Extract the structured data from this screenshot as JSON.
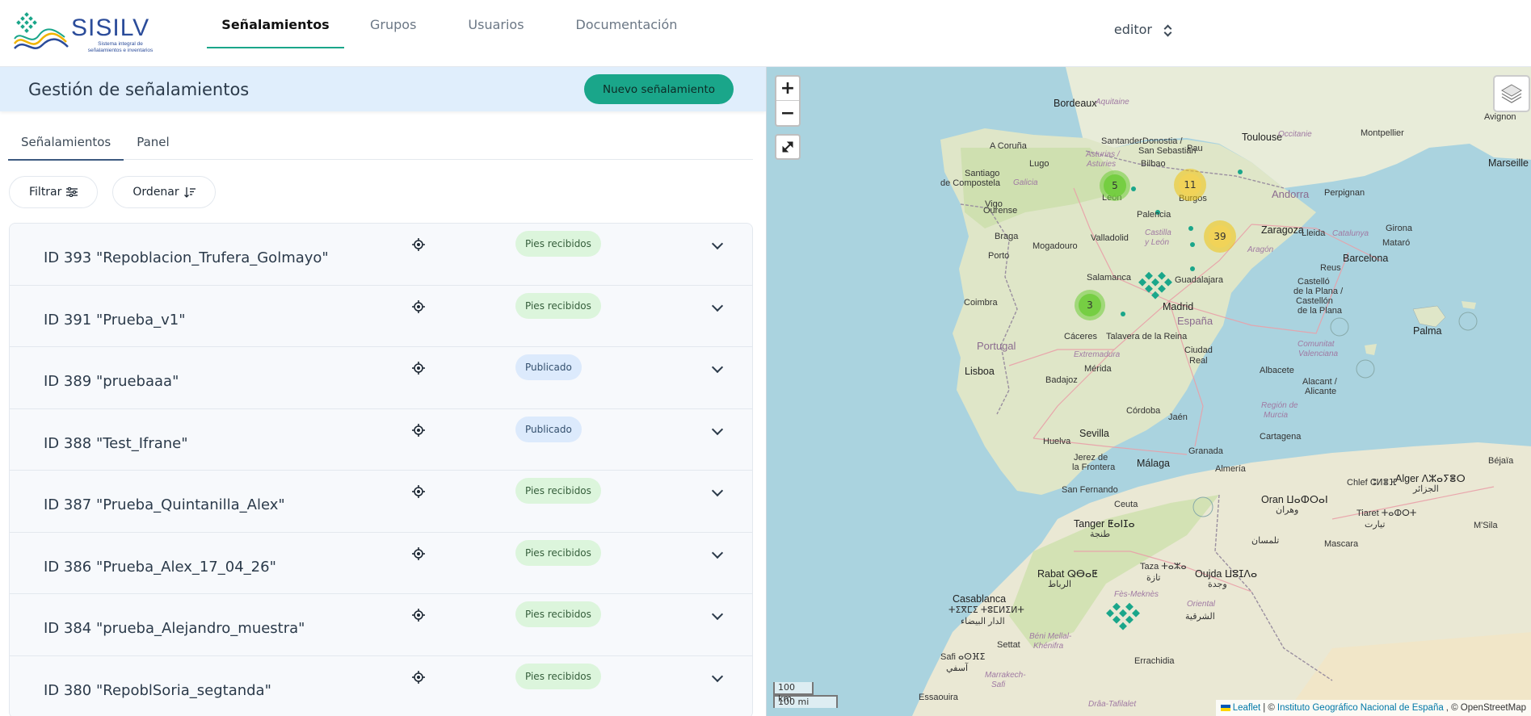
{
  "app": {
    "logo_text": "SISILV",
    "logo_subtitle": "Sistema integral de señalamientos e inventarios"
  },
  "nav": {
    "items": [
      {
        "label": "Señalamientos",
        "active": true
      },
      {
        "label": "Grupos",
        "active": false
      },
      {
        "label": "Usuarios",
        "active": false
      },
      {
        "label": "Documentación",
        "active": false
      }
    ],
    "user": "editor"
  },
  "panel": {
    "title": "Gestión de señalamientos",
    "new_button": "Nuevo señalamiento",
    "tabs": [
      {
        "label": "Señalamientos",
        "active": true
      },
      {
        "label": "Panel",
        "active": false
      }
    ],
    "filter_label": "Filtrar",
    "sort_label": "Ordenar",
    "rows": [
      {
        "title": "ID 393 \"Repoblacion_Trufera_Golmayo\"",
        "status": "Pies recibidos",
        "status_color": "green"
      },
      {
        "title": "ID 391 \"Prueba_v1\"",
        "status": "Pies recibidos",
        "status_color": "green"
      },
      {
        "title": "ID 389 \"pruebaaa\"",
        "status": "Publicado",
        "status_color": "blue"
      },
      {
        "title": "ID 388 \"Test_Ifrane\"",
        "status": "Publicado",
        "status_color": "blue"
      },
      {
        "title": "ID 387 \"Prueba_Quintanilla_Alex\"",
        "status": "Pies recibidos",
        "status_color": "green"
      },
      {
        "title": "ID 386 \"Prueba_Alex_17_04_26\"",
        "status": "Pies recibidos",
        "status_color": "green"
      },
      {
        "title": "ID 384 \"prueba_Alejandro_muestra\"",
        "status": "Pies recibidos",
        "status_color": "green"
      },
      {
        "title": "ID 380 \"RepoblSoria_segtanda\"",
        "status": "Pies recibidos",
        "status_color": "green"
      }
    ]
  },
  "map": {
    "zoom_in": "+",
    "zoom_out": "−",
    "clusters": [
      {
        "count": "5",
        "color": "green"
      },
      {
        "count": "11",
        "color": "yellow"
      },
      {
        "count": "39",
        "color": "yellow"
      },
      {
        "count": "3",
        "color": "green"
      }
    ],
    "scale_km": "100 km",
    "scale_mi": "100 mi",
    "attribution": {
      "leaflet": "Leaflet",
      "sep": "| ©",
      "ign": "Instituto Geográfico Nacional de España",
      "osm": ", © OpenStreetMap"
    },
    "labels": {
      "bordeaux": "Bordeaux",
      "aquitaine": "Aquitaine",
      "toulouse": "Toulouse",
      "occitanie": "Occitanie",
      "montpellier": "Montpellier",
      "avignon": "Avignon",
      "marseille": "Marseille",
      "pau": "Pau",
      "andorra": "Andorra",
      "perpignan": "Perpignan",
      "santander": "Santander",
      "bilbao": "Bilbao",
      "donostia": "Donostia /",
      "sansebastian": "San Sebastián",
      "acoruna": "A Coruña",
      "lugo": "Lugo",
      "asturias": "Asturias /",
      "asturies": "Asturies",
      "santiago": "Santiago",
      "decompostela": "de Compostela",
      "galicia": "Galicia",
      "ourense": "Ourense",
      "leon": "León",
      "burgos": "Burgos",
      "palencia": "Palencia",
      "vigo": "Vigo",
      "braga": "Braga",
      "porto": "Porto",
      "mogadouro": "Mogadouro",
      "valladolid": "Valladolid",
      "castilla": "Castilla",
      "yleon": "y León",
      "zaragoza": "Zaragoza",
      "lleida": "Lleida",
      "catalunya": "Catalunya",
      "girona": "Girona",
      "mataro": "Mataró",
      "barcelona": "Barcelona",
      "aragon": "Aragón",
      "salamanca": "Salamanca",
      "guadalajara": "Guadalajara",
      "madrid": "Madrid",
      "espana": "España",
      "coimbra": "Coimbra",
      "portugal": "Portugal",
      "caceres": "Cáceres",
      "talavera": "Talavera de la Reina",
      "extremadura": "Extremadura",
      "ciudad": "Ciudad",
      "real": "Real",
      "lisboa": "Lisboa",
      "badajoz": "Badajoz",
      "merida": "Mérida",
      "albacete": "Albacete",
      "castello1": "Castelló",
      "castello2": "de la Plana /",
      "castello3": "Castellón",
      "castello4": "de la Plana",
      "reus": "Reus",
      "palma": "Palma",
      "comunitat": "Comunitat",
      "valenciana": "Valenciana",
      "alacant": "Alacant /",
      "alicante": "Alicante",
      "cordoba": "Córdoba",
      "jaen": "Jaén",
      "regiondemurcia": "Región de",
      "murcia": "Murcia",
      "sevilla": "Sevilla",
      "huelva": "Huelva",
      "jerez1": "Jerez de",
      "jerez2": "la Frontera",
      "granada": "Granada",
      "malaga": "Málaga",
      "almeria": "Almería",
      "cartagena": "Cartagena",
      "sanfernando": "San Fernando",
      "ceuta": "Ceuta",
      "tanger": "Tanger ⵟⴰⵏⵊⴰ",
      "tanger_ar": "طنجة",
      "oran": "Oran ⵡⴰⵀⵔⴰⵏ",
      "oran_ar": "وهران",
      "chlef": "Chlef ⵛⵍⴻⴼ",
      "alger": "Alger ⴷⵣⴰⵢⴻⵔ",
      "alger_ar": "الجزائر",
      "bejaia": "Béjaïa",
      "tiaret": "Tiaret ⵜⴰⵀⵔⵜ",
      "tiaret_ar": "تيارت",
      "rabat": "Rabat ⵕⴱⴰⵟ",
      "rabat_ar": "الرباط",
      "taza": "Taza ⵜⴰⵣⴰ",
      "taza_ar": "تازة",
      "oujda": "Oujda ⵡⵓⵊⴷⴰ",
      "oujda_ar": "وجدة",
      "casablanca": "Casablanca",
      "casablanca_tf": "ⵜⵉⴳⵎⵉ ⵜⵓⵎⵍⵉⵍⵜ",
      "casablanca_ar": "الدار البيضاء",
      "fesmeknes": "Fès-Meknès",
      "oriental": "Oriental",
      "oriental_ar": "الشرقية",
      "beni1": "Béni Mellal-",
      "beni2": "Khénifra",
      "settat": "Settat",
      "safi": "Safi ⴰⵙⴼⵉ",
      "safi_ar": "آسفي",
      "marrakech": "Marrakech-",
      "safi2": "Safi",
      "errachidia": "Errachidia",
      "draa": "Drâa-Tafilalet",
      "essaouira": "Essaouira",
      "mascara": "Mascara",
      "tlemcen": "تلمسان",
      "msila": "M'Sila"
    }
  }
}
